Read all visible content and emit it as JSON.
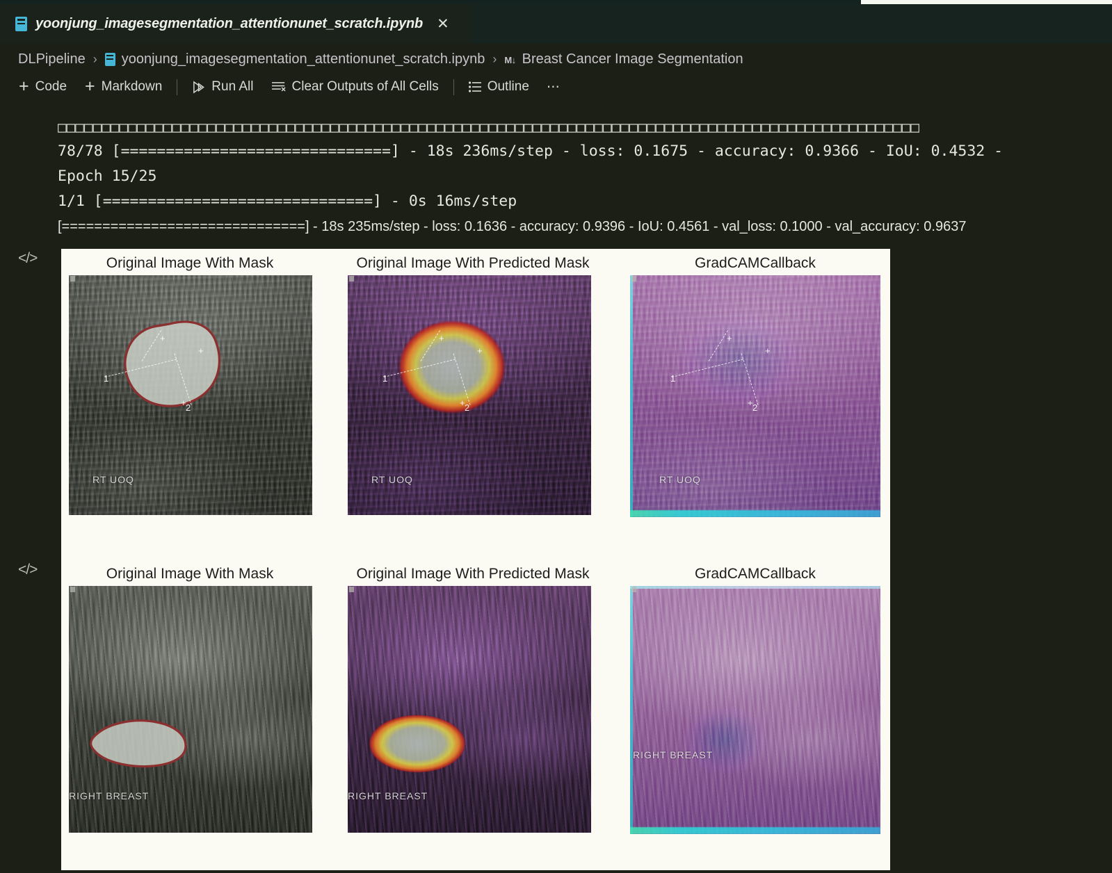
{
  "window": {
    "tab": {
      "filename": "yoonjung_imagesegmentation_attentionunet_scratch.ipynb",
      "close_label": "✕"
    }
  },
  "breadcrumb": {
    "root": "DLPipeline",
    "separator": "›",
    "file": "yoonjung_imagesegmentation_attentionunet_scratch.ipynb",
    "markdown_badge": "M↓",
    "section": "Breast Cancer Image Segmentation"
  },
  "toolbar": {
    "add_code": "Code",
    "add_markdown": "Markdown",
    "run_all": "Run All",
    "clear_outputs": "Clear Outputs of All Cells",
    "outline": "Outline",
    "more": "⋯",
    "plus": "+"
  },
  "output": {
    "lines": [
      "□□□□□□□□□□□□□□□□□□□□□□□□□□□□□□□□□□□□□□□□□□□□□□□□□□□□□□□□□□□□□□□□□□□□□□□□□□□□□□□□□□□□□□□□□□□□□□□□□□",
      "78/78 [==============================] - 18s 236ms/step - loss: 0.1675 - accuracy: 0.9366 - IoU: 0.4532 -",
      "Epoch 15/25",
      "1/1 [==============================] - 0s 16ms/step",
      "[==============================] - 18s 235ms/step - loss: 0.1636 - accuracy: 0.9396 - IoU: 0.4561 - val_loss: 0.1000 - val_accuracy: 0.9637"
    ],
    "epoch": "Epoch 15/25",
    "batches": "78/78",
    "metrics": {
      "loss": "0.1675",
      "accuracy": "0.9366",
      "IoU": "0.4532",
      "val_loss": "0.1000",
      "val_accuracy": "0.9637",
      "epoch_loss": "0.1636",
      "epoch_accuracy": "0.9396",
      "epoch_IoU": "0.4561",
      "time_per_step": "236ms/step",
      "epoch_time": "18s"
    }
  },
  "cells": [
    {
      "marker": "</>",
      "panels": [
        {
          "title": "Original Image With Mask",
          "overlay_label": "RT UOQ"
        },
        {
          "title": "Original Image With Predicted Mask",
          "overlay_label": "RT UOQ"
        },
        {
          "title": "GradCAMCallback",
          "overlay_label": "RT UOQ"
        }
      ]
    },
    {
      "marker": "</>",
      "panels": [
        {
          "title": "Original Image With Mask",
          "overlay_label": "RIGHT BREAST"
        },
        {
          "title": "Original Image With Predicted Mask",
          "overlay_label": "RIGHT BREAST"
        },
        {
          "title": "GradCAMCallback",
          "overlay_label": "RIGHT BREAST"
        }
      ]
    }
  ],
  "calipers": {
    "one": "1",
    "two": "2",
    "plus": "+"
  },
  "colors": {
    "editor_bg": "#1b1f16",
    "tabbar_bg": "#16231f",
    "tab_active_bg": "#1b221b",
    "figure_bg": "#fbfaf3",
    "accent_blue": "#45b6d6",
    "text_primary": "#e6e8df",
    "mask_contour": "#8b2f2f"
  }
}
